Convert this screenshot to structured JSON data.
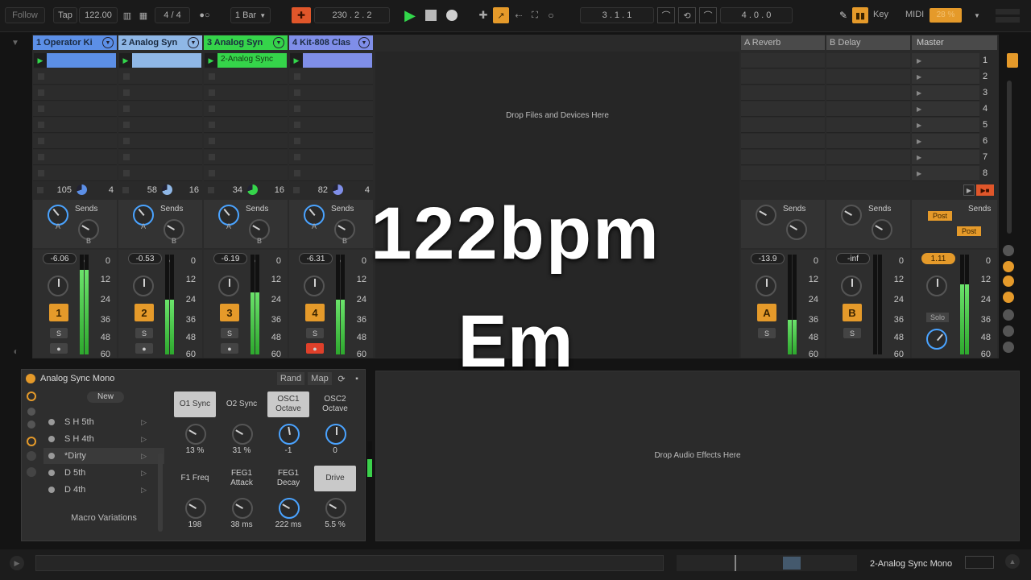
{
  "transport": {
    "follow": "Follow",
    "tap": "Tap",
    "tempo": "122.00",
    "signature": "4 / 4",
    "quantize": "1 Bar",
    "position": "230 .  2 .  2",
    "loop_start": "3 .  1 .  1",
    "loop_len": "4 .  0 .  0",
    "key": "Key",
    "midi": "MIDI",
    "cpu": "28 %"
  },
  "tracks": [
    {
      "name": "1 Operator Ki",
      "color": "#5c8fe6",
      "val_left": "105",
      "val_right": "4",
      "volume": "-6.06",
      "num": "1",
      "meter": 0.85
    },
    {
      "name": "2 Analog Syn",
      "color": "#8fb7e6",
      "val_left": "58",
      "val_right": "16",
      "volume": "-0.53",
      "num": "2",
      "meter": 0.55
    },
    {
      "name": "3 Analog Syn",
      "color": "#35d44a",
      "val_left": "34",
      "val_right": "16",
      "volume": "-6.19",
      "num": "3",
      "meter": 0.62,
      "clip": "2-Analog Sync"
    },
    {
      "name": "4 Kit-808 Clas",
      "color": "#7f8ee8",
      "val_left": "82",
      "val_right": "4",
      "volume": "-6.31",
      "num": "4",
      "meter": 0.55
    }
  ],
  "returns": [
    {
      "name": "A Reverb",
      "volume": "-13.9",
      "num": "A",
      "meter": 0.35
    },
    {
      "name": "B Delay",
      "volume": "-inf",
      "num": "B",
      "meter": 0
    }
  ],
  "master": {
    "name": "Master",
    "volume": "1.11",
    "scenes": [
      "1",
      "2",
      "3",
      "4",
      "5",
      "6",
      "7",
      "8"
    ],
    "post": "Post",
    "solo": "Solo",
    "meter": 0.7
  },
  "mixer": {
    "sends": "Sends",
    "a": "A",
    "b": "B",
    "s": "S",
    "scale": [
      "0",
      "12",
      "24",
      "36",
      "48",
      "60"
    ]
  },
  "drop_files": "Drop Files and Devices Here",
  "drop_effects": "Drop Audio Effects Here",
  "overlay": {
    "bpm": "122bpm",
    "key": "Em"
  },
  "device": {
    "title": "Analog Sync Mono",
    "rand": "Rand",
    "map": "Map",
    "new": "New",
    "presets": [
      "S H 5th",
      "S H 4th",
      "*Dirty",
      "D 5th",
      "D 4th"
    ],
    "variations": "Macro Variations",
    "macros": [
      {
        "label": "O1 Sync",
        "value": "13 %",
        "on": true
      },
      {
        "label": "O2 Sync",
        "value": "31 %",
        "on": false
      },
      {
        "label": "OSC1 Octave",
        "value": "-1",
        "on": true
      },
      {
        "label": "OSC2 Octave",
        "value": "0",
        "on": false
      },
      {
        "label": "F1 Freq",
        "value": "198",
        "on": false
      },
      {
        "label": "FEG1 Attack",
        "value": "38 ms",
        "on": false
      },
      {
        "label": "FEG1 Decay",
        "value": "222 ms",
        "on": false
      },
      {
        "label": "Drive",
        "value": "5.5 %",
        "on": true
      }
    ]
  },
  "status": {
    "track_name": "2-Analog Sync Mono"
  }
}
